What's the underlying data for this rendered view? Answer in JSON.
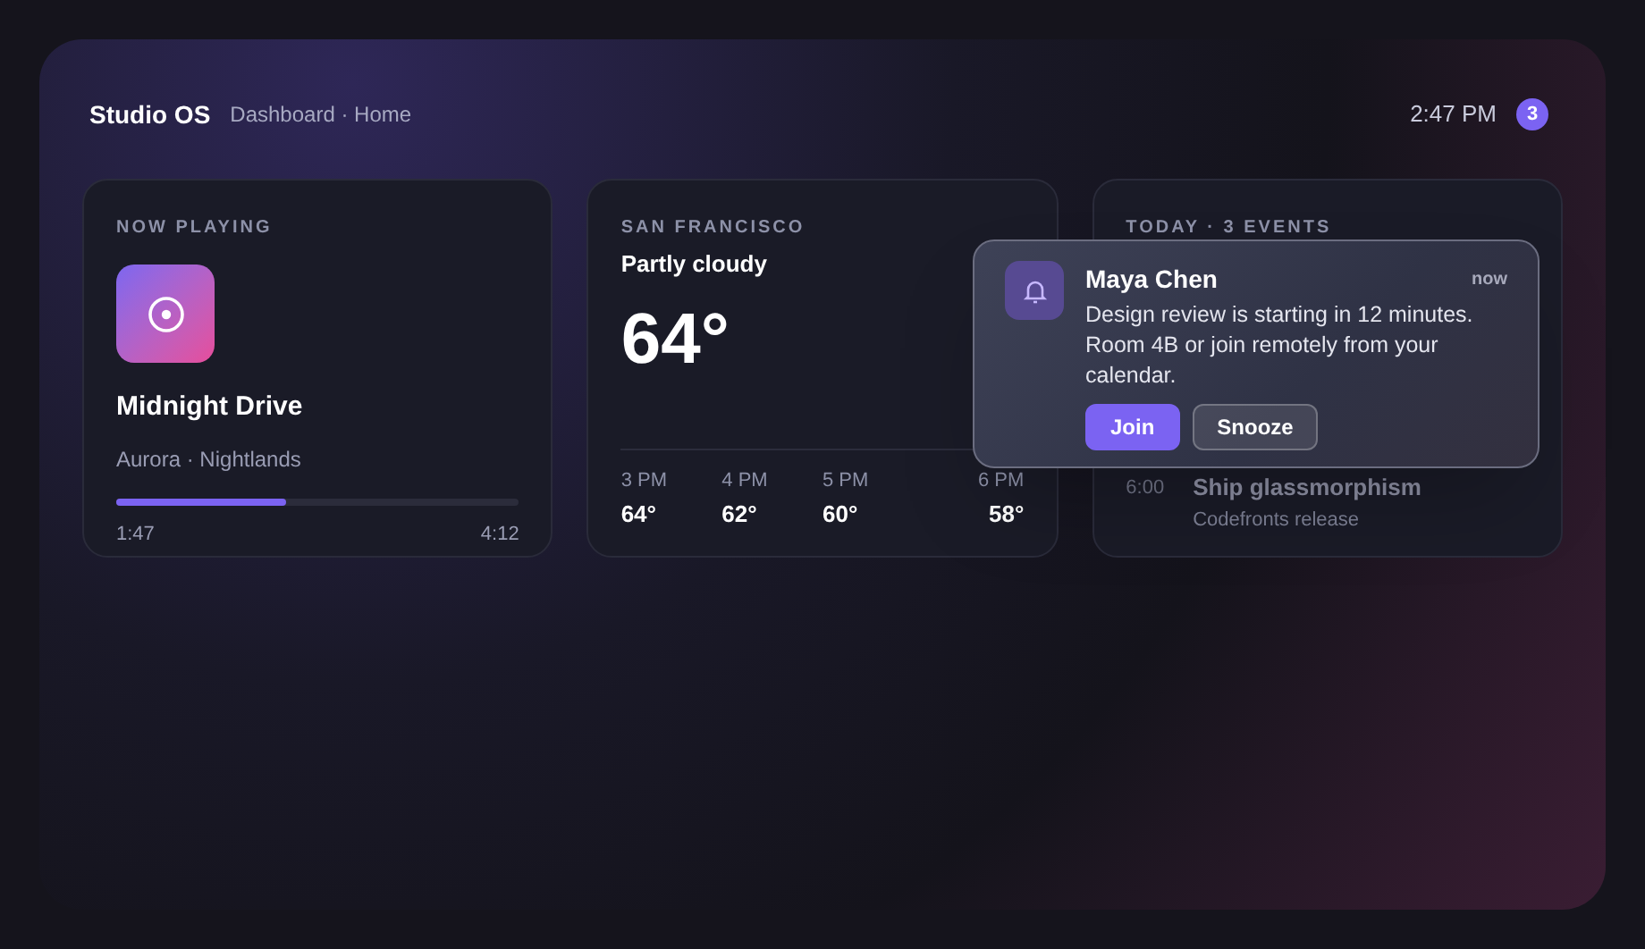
{
  "header": {
    "brand": "Studio OS",
    "breadcrumb": "Dashboard · Home",
    "time": "2:47 PM",
    "badge": "3"
  },
  "now_playing": {
    "label": "NOW PLAYING",
    "title": "Midnight Drive",
    "subtitle": "Aurora · Nightlands",
    "level": 0.42,
    "elapsed": "1:47",
    "duration": "4:12"
  },
  "weather": {
    "city": "SAN FRANCISCO",
    "condition": "Partly cloudy",
    "temperature": "64°",
    "forecast": [
      {
        "time": "3 PM",
        "temp": "64°"
      },
      {
        "time": "4 PM",
        "temp": "62°"
      },
      {
        "time": "5 PM",
        "temp": "60°"
      },
      {
        "time": "6 PM",
        "temp": "58°"
      }
    ]
  },
  "calendar": {
    "label": "TODAY · 3 EVENTS",
    "events": [
      {
        "time": "6:00",
        "title": "Ship glassmorphism",
        "subtitle": "Codefronts release"
      }
    ]
  },
  "notification": {
    "sender": "Maya Chen",
    "time": "now",
    "message": "Design review is starting in 12 minutes. Room 4B or join remotely from your calendar.",
    "buttons": [
      {
        "label": "Join",
        "kind": "primary"
      },
      {
        "label": "Snooze",
        "kind": "secondary"
      }
    ]
  }
}
